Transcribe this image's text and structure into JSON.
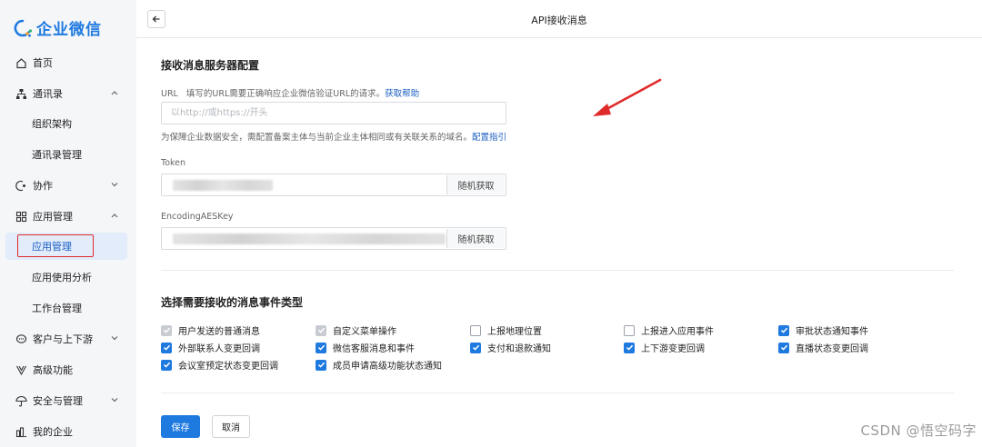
{
  "app": {
    "name": "企业微信"
  },
  "sidebar": {
    "items": [
      {
        "label": "首页"
      },
      {
        "label": "通讯录"
      },
      {
        "label": "组织架构"
      },
      {
        "label": "通讯录管理"
      },
      {
        "label": "协作"
      },
      {
        "label": "应用管理"
      },
      {
        "label": "应用管理"
      },
      {
        "label": "应用使用分析"
      },
      {
        "label": "工作台管理"
      },
      {
        "label": "客户与上下游"
      },
      {
        "label": "高级功能"
      },
      {
        "label": "安全与管理"
      },
      {
        "label": "我的企业"
      }
    ]
  },
  "header": {
    "title": "API接收消息"
  },
  "server_config": {
    "title": "接收消息服务器配置",
    "url_label": "URL",
    "url_hint": "填写的URL需要正确响应企业微信验证URL的请求。",
    "url_help_link": "获取帮助",
    "url_placeholder": "以http://或https://开头",
    "url_note": "为保障企业数据安全，需配置备案主体与当前企业主体相同或有关联关系的域名。",
    "url_note_link": "配置指引",
    "token_label": "Token",
    "token_button": "随机获取",
    "aeskey_label": "EncodingAESKey",
    "aeskey_button": "随机获取"
  },
  "events": {
    "title": "选择需要接收的消息事件类型",
    "items": [
      {
        "label": "用户发送的普通消息",
        "state": "disabled-checked"
      },
      {
        "label": "自定义菜单操作",
        "state": "disabled-checked"
      },
      {
        "label": "上报地理位置",
        "state": "unchecked"
      },
      {
        "label": "上报进入应用事件",
        "state": "unchecked"
      },
      {
        "label": "审批状态通知事件",
        "state": "checked"
      },
      {
        "label": "外部联系人变更回调",
        "state": "checked"
      },
      {
        "label": "微信客服消息和事件",
        "state": "checked"
      },
      {
        "label": "支付和退款通知",
        "state": "checked"
      },
      {
        "label": "上下游变更回调",
        "state": "checked"
      },
      {
        "label": "直播状态变更回调",
        "state": "checked"
      },
      {
        "label": "会议室预定状态变更回调",
        "state": "checked"
      },
      {
        "label": "成员申请高级功能状态通知",
        "state": "checked"
      }
    ]
  },
  "actions": {
    "save": "保存",
    "cancel": "取消"
  },
  "watermark": "CSDN @悟空码字",
  "colors": {
    "accent": "#1f7ae0",
    "annotation": "#e02b2b"
  }
}
